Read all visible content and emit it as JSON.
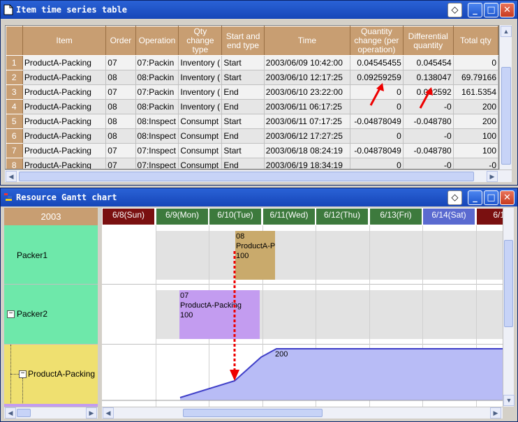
{
  "table_window": {
    "title": "Item time series table",
    "columns": [
      "Item",
      "Order",
      "Operation",
      "Qty change type",
      "Start and end type",
      "Time",
      "Quantity change (per operation)",
      "Differential quantity",
      "Total qty"
    ],
    "rows": [
      {
        "n": "1",
        "item": "ProductA-Packing",
        "order": "07",
        "op": "07:Packin",
        "qtytype": "Inventory (",
        "se": "Start",
        "time": "2003/06/09 10:42:00",
        "qc": "0.04545455",
        "dq": "0.045454",
        "tq": "0"
      },
      {
        "n": "2",
        "item": "ProductA-Packing",
        "order": "08",
        "op": "08:Packin",
        "qtytype": "Inventory (",
        "se": "Start",
        "time": "2003/06/10 12:17:25",
        "qc": "0.09259259",
        "dq": "0.138047",
        "tq": "69.79166"
      },
      {
        "n": "3",
        "item": "ProductA-Packing",
        "order": "07",
        "op": "07:Packin",
        "qtytype": "Inventory (",
        "se": "End",
        "time": "2003/06/10 23:22:00",
        "qc": "0",
        "dq": "0.092592",
        "tq": "161.5354"
      },
      {
        "n": "4",
        "item": "ProductA-Packing",
        "order": "08",
        "op": "08:Packin",
        "qtytype": "Inventory (",
        "se": "End",
        "time": "2003/06/11 06:17:25",
        "qc": "0",
        "dq": "-0",
        "tq": "200"
      },
      {
        "n": "5",
        "item": "ProductA-Packing",
        "order": "08",
        "op": "08:Inspect",
        "qtytype": "Consumpt",
        "se": "Start",
        "time": "2003/06/11 07:17:25",
        "qc": "-0.04878049",
        "dq": "-0.048780",
        "tq": "200"
      },
      {
        "n": "6",
        "item": "ProductA-Packing",
        "order": "08",
        "op": "08:Inspect",
        "qtytype": "Consumpt",
        "se": "End",
        "time": "2003/06/12 17:27:25",
        "qc": "0",
        "dq": "-0",
        "tq": "100"
      },
      {
        "n": "7",
        "item": "ProductA-Packing",
        "order": "07",
        "op": "07:Inspect",
        "qtytype": "Consumpt",
        "se": "Start",
        "time": "2003/06/18 08:24:19",
        "qc": "-0.04878049",
        "dq": "-0.048780",
        "tq": "100"
      },
      {
        "n": "8",
        "item": "ProductA-Packing",
        "order": "07",
        "op": "07:Inspect",
        "qtytype": "Consumpt",
        "se": "End",
        "time": "2003/06/19 18:34:19",
        "qc": "0",
        "dq": "-0",
        "tq": "-0"
      }
    ]
  },
  "gantt_window": {
    "title": "Resource Gantt chart",
    "year": "2003",
    "resources": [
      "Packer1",
      "Packer2",
      "ProductA-Packing"
    ],
    "days": [
      {
        "label": "6/8(Sun)",
        "color": "#7a1010"
      },
      {
        "label": "6/9(Mon)",
        "color": "#3d7a3d"
      },
      {
        "label": "6/10(Tue)",
        "color": "#3d7a3d"
      },
      {
        "label": "6/11(Wed)",
        "color": "#3d7a3d"
      },
      {
        "label": "6/12(Thu)",
        "color": "#3d7a3d"
      },
      {
        "label": "6/13(Fri)",
        "color": "#3d7a3d"
      },
      {
        "label": "6/14(Sat)",
        "color": "#5a6ad0"
      },
      {
        "label": "6/15(",
        "color": "#7a1010"
      }
    ],
    "tasks": [
      {
        "order": "08",
        "item": "ProductA-Packing",
        "qty": "100",
        "color": "#c9aa6c"
      },
      {
        "order": "07",
        "item": "ProductA-Packing",
        "qty": "100",
        "color": "#c39cf0"
      }
    ],
    "inventory_label": "200"
  }
}
